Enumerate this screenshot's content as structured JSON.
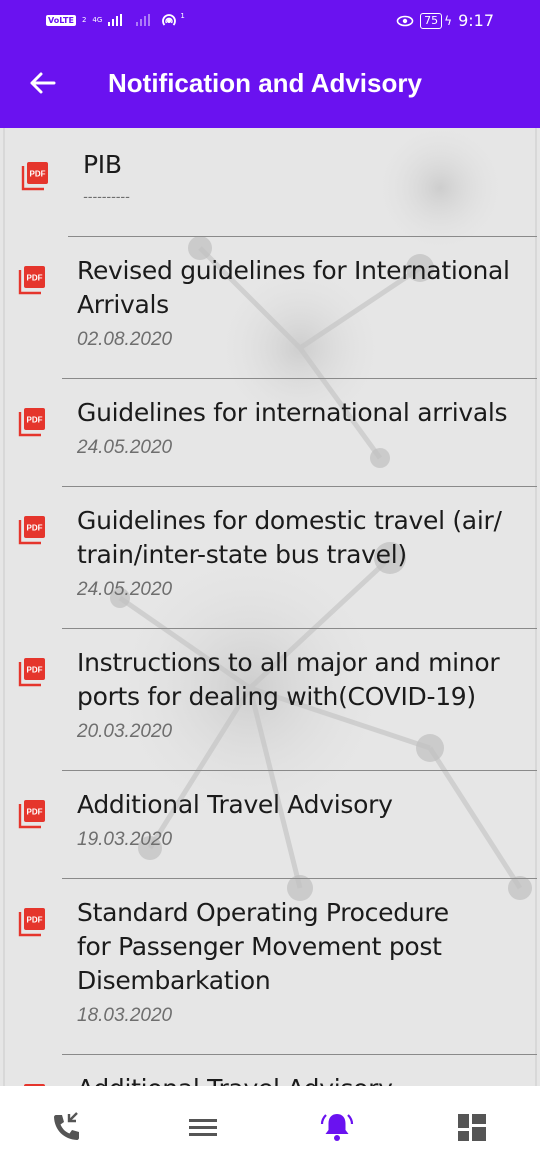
{
  "status_bar": {
    "volte": "VoLTE",
    "sim_slot": "2",
    "network": "4G",
    "hotspot_count": "1",
    "battery": "75",
    "time": "9:17"
  },
  "header": {
    "title": "Notification and Advisory",
    "back_icon": "arrow-left-icon"
  },
  "list": {
    "file_icon": "pdf-file-icon",
    "items": [
      {
        "title": "PIB",
        "date": "----------"
      },
      {
        "title": "Revised guidelines for International Arrivals",
        "date": "02.08.2020"
      },
      {
        "title": "Guidelines for international arrivals",
        "date": "24.05.2020"
      },
      {
        "title": "Guidelines for domestic travel (air/ train/inter-state bus travel)",
        "date": "24.05.2020"
      },
      {
        "title": "Instructions to all major and minor ports for dealing with(COVID-19)",
        "date": "20.03.2020"
      },
      {
        "title": "Additional Travel Advisory",
        "date": "19.03.2020"
      },
      {
        "title": "Standard Operating Procedure for Passenger Movement post Disembarkation",
        "date": "18.03.2020"
      },
      {
        "title": "Additional Travel Advisory",
        "date": ""
      }
    ]
  },
  "bottom_nav": {
    "items": [
      {
        "icon": "phone-call-icon",
        "active": false
      },
      {
        "icon": "menu-icon",
        "active": false
      },
      {
        "icon": "notification-bell-icon",
        "active": true
      },
      {
        "icon": "dashboard-icon",
        "active": false
      }
    ],
    "active_color": "#6a12f0",
    "inactive_color": "#555555"
  },
  "colors": {
    "primary": "#6a12f0",
    "pdf_red": "#e5352c"
  }
}
